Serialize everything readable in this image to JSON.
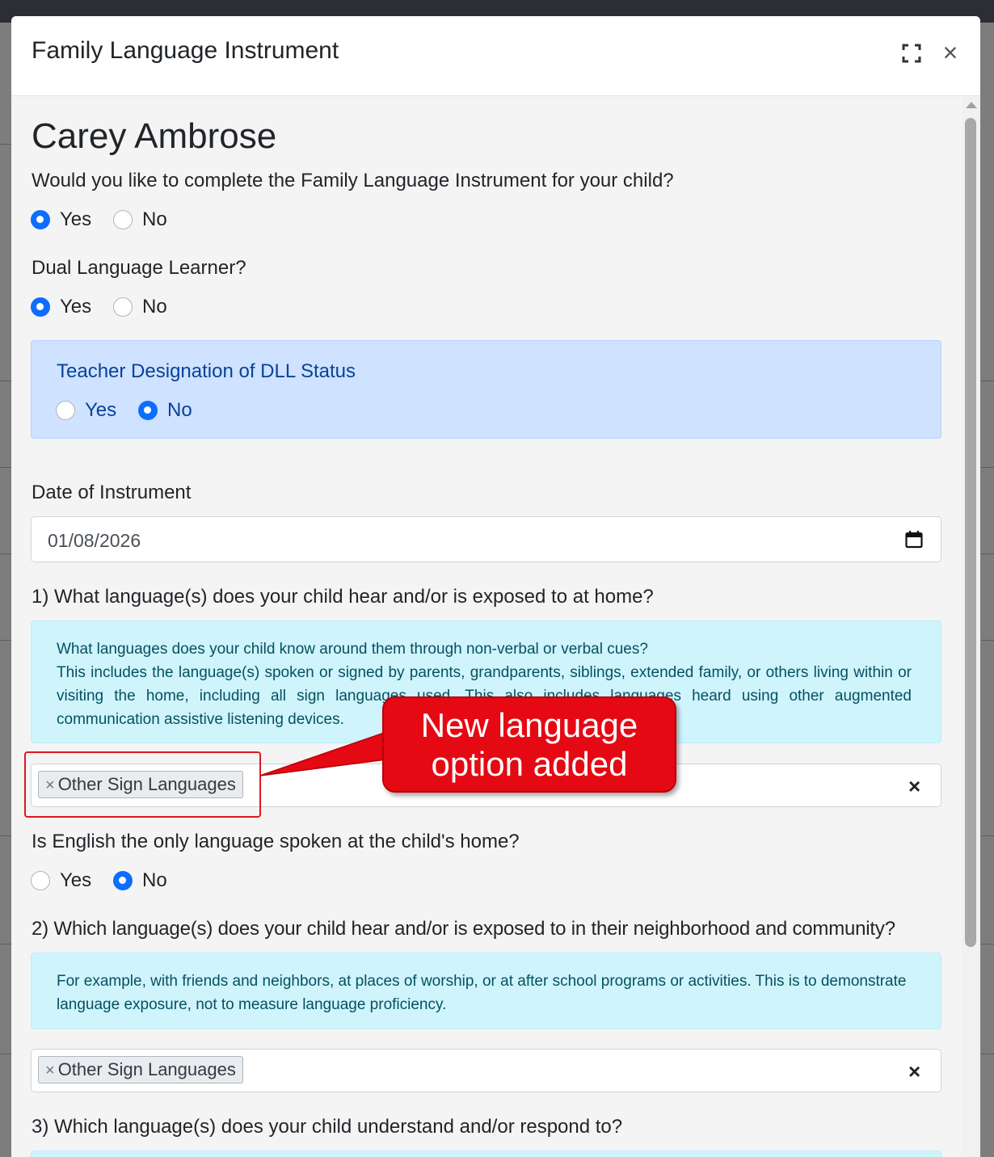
{
  "modal": {
    "title": "Family Language Instrument",
    "expand_icon": "expand-icon",
    "close_icon": "close-icon",
    "close_glyph": "×"
  },
  "student": {
    "name": "Carey Ambrose"
  },
  "complete_question": {
    "label": "Would you like to complete the Family Language Instrument for your child?",
    "options": [
      "Yes",
      "No"
    ],
    "selected": "Yes"
  },
  "dll_question": {
    "label": "Dual Language Learner?",
    "options": [
      "Yes",
      "No"
    ],
    "selected": "Yes"
  },
  "teacher_designation": {
    "label": "Teacher Designation of DLL Status",
    "options": [
      "Yes",
      "No"
    ],
    "selected": "No"
  },
  "date": {
    "label": "Date of Instrument",
    "value": "01/08/2026",
    "icon": "calendar-icon"
  },
  "q1": {
    "label": "1) What language(s) does your child hear and/or is exposed to at home?",
    "info_line1": "What languages does your child know around them through non-verbal or verbal cues?",
    "info_line2": "This includes the language(s) spoken or signed by parents, grandparents, siblings, extended family, or others living within or visiting the home, including all sign languages used. This also includes languages heard using other augmented communication assistive listening devices.",
    "selected_tag": "Other Sign Languages",
    "tag_remove": "×",
    "clear": "×"
  },
  "english_only": {
    "label": "Is English the only language spoken at the child's home?",
    "options": [
      "Yes",
      "No"
    ],
    "selected": "No"
  },
  "q2": {
    "label": "2) Which language(s) does your child hear and/or is exposed to in their neighborhood and community?",
    "info": "For example, with friends and neighbors, at places of worship, or at after school programs or activities. This is to demonstrate language exposure, not to measure language proficiency.",
    "selected_tag": "Other Sign Languages",
    "tag_remove": "×",
    "clear": "×"
  },
  "q3": {
    "label": "3) Which language(s) does your child understand and/or respond to?"
  },
  "annotation": {
    "callout_line1": "New language",
    "callout_line2": "option added",
    "color": "#e50914"
  },
  "colors": {
    "primary": "#0d6efd",
    "dll_bg": "#cfe2ff",
    "info_bg": "#cff4fc"
  }
}
